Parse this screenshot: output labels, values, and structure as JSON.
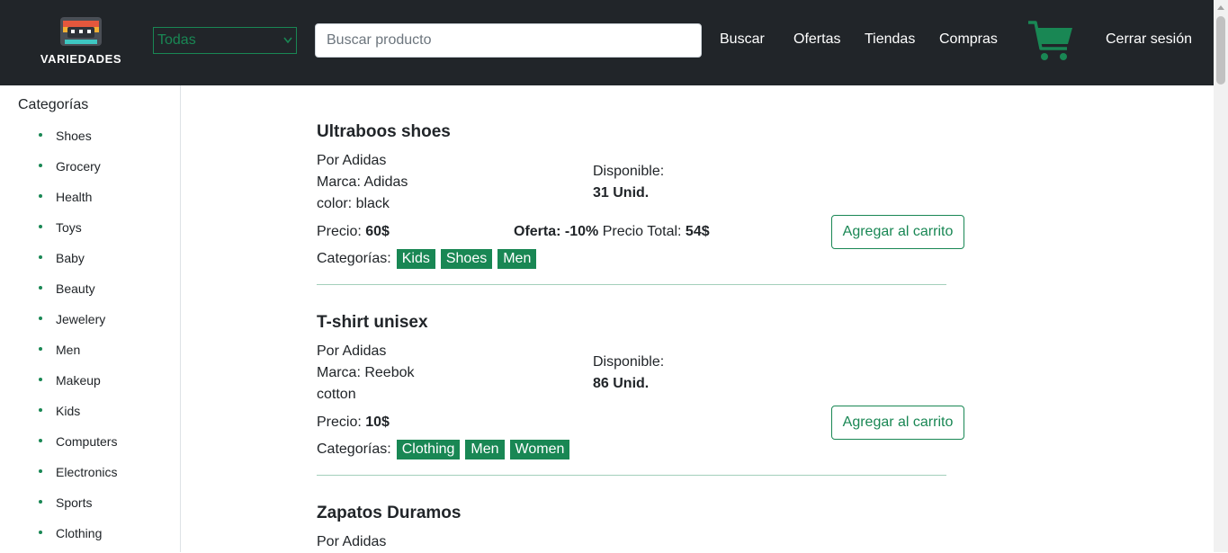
{
  "header": {
    "logo_text": "VARIEDADES",
    "category_select": "Todas",
    "search_placeholder": "Buscar producto",
    "nav": [
      "Buscar",
      "Ofertas",
      "Tiendas",
      "Compras"
    ],
    "logout": "Cerrar sesión",
    "cart_icon": "shopping-cart-icon"
  },
  "sidebar": {
    "title": "Categorías",
    "items": [
      "Shoes",
      "Grocery",
      "Health",
      "Toys",
      "Baby",
      "Beauty",
      "Jewelery",
      "Men",
      "Makeup",
      "Kids",
      "Computers",
      "Electronics",
      "Sports",
      "Clothing"
    ]
  },
  "labels": {
    "available": "Disponible:",
    "price": "Precio:",
    "offer": "Oferta:",
    "total_price": "Precio Total:",
    "categories": "Categorías:",
    "add_to_cart": "Agregar al carrito"
  },
  "products": [
    {
      "name": "Ultraboos shoes",
      "by": "Por Adidas",
      "brand": "Marca: Adidas",
      "detail": "color: black",
      "stock": "31 Unid.",
      "price": "60$",
      "offer": "-10%",
      "total": "54$",
      "categories": [
        "Kids",
        "Shoes",
        "Men"
      ]
    },
    {
      "name": "T-shirt unisex",
      "by": "Por Adidas",
      "brand": "Marca: Reebok",
      "detail": "cotton",
      "stock": "86 Unid.",
      "price": "10$",
      "categories": [
        "Clothing",
        "Men",
        "Women"
      ]
    },
    {
      "name": "Zapatos Duramos",
      "by": "Por Adidas"
    }
  ],
  "colors": {
    "navbar": "#212529",
    "accent": "#198754",
    "divider": "#a3cfbb"
  }
}
